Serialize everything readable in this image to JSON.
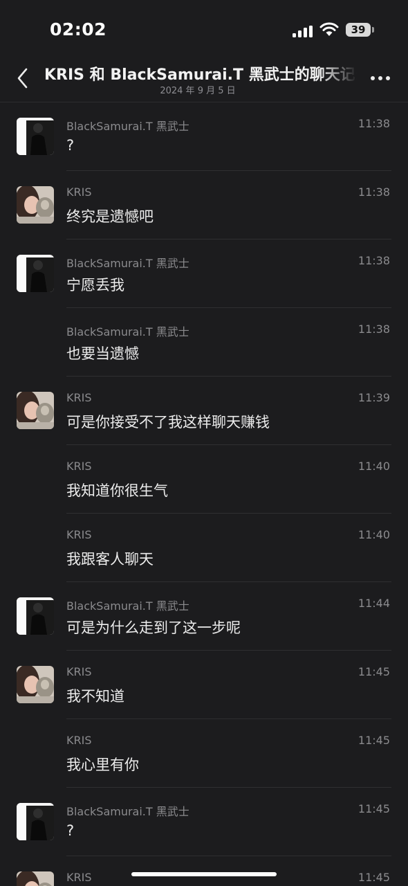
{
  "status_bar": {
    "time": "02:02",
    "battery": "39"
  },
  "header": {
    "title": "KRIS 和 BlackSamurai.T 黑武士的聊天记录",
    "subtitle": "2024 年 9 月 5 日"
  },
  "messages": [
    {
      "sender": "BlackSamurai.T 黑武士",
      "time": "11:38",
      "text": "?",
      "avatar": "black"
    },
    {
      "sender": "KRIS",
      "time": "11:38",
      "text": "终究是遗憾吧",
      "avatar": "kris"
    },
    {
      "sender": "BlackSamurai.T 黑武士",
      "time": "11:38",
      "text": "宁愿丢我",
      "avatar": "black"
    },
    {
      "sender": "BlackSamurai.T 黑武士",
      "time": "11:38",
      "text": "也要当遗憾",
      "avatar": ""
    },
    {
      "sender": "KRIS",
      "time": "11:39",
      "text": "可是你接受不了我这样聊天赚钱",
      "avatar": "kris"
    },
    {
      "sender": "KRIS",
      "time": "11:40",
      "text": "我知道你很生气",
      "avatar": ""
    },
    {
      "sender": "KRIS",
      "time": "11:40",
      "text": "我跟客人聊天",
      "avatar": ""
    },
    {
      "sender": "BlackSamurai.T 黑武士",
      "time": "11:44",
      "text": "可是为什么走到了这一步呢",
      "avatar": "black"
    },
    {
      "sender": "KRIS",
      "time": "11:45",
      "text": "我不知道",
      "avatar": "kris"
    },
    {
      "sender": "KRIS",
      "time": "11:45",
      "text": "我心里有你",
      "avatar": ""
    },
    {
      "sender": "BlackSamurai.T 黑武士",
      "time": "11:45",
      "text": "?",
      "avatar": "black"
    },
    {
      "sender": "KRIS",
      "time": "11:45",
      "text": "",
      "avatar": "kris"
    }
  ]
}
